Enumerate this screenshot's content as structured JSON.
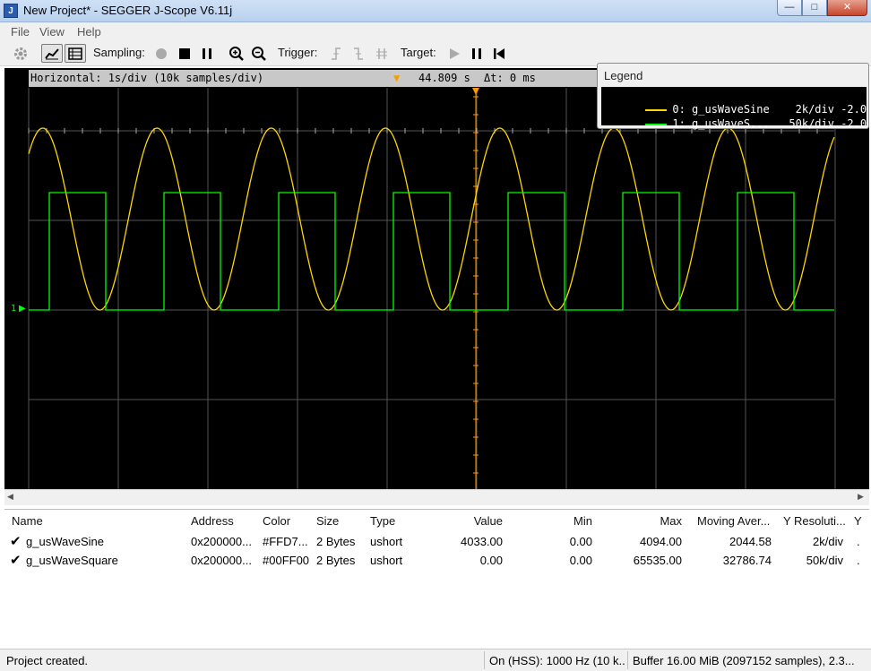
{
  "window": {
    "title": "New Project* - SEGGER J-Scope V6.11j",
    "app_icon": "J",
    "minimize": "—",
    "maximize": "□",
    "close": "✕"
  },
  "menu": [
    "File",
    "View",
    "Help"
  ],
  "toolbar": {
    "sampling_label": "Sampling:",
    "trigger_label": "Trigger:",
    "target_label": "Target:",
    "icons": [
      "gear-icon",
      "graph-view-icon",
      "table-view-icon",
      "record-icon",
      "stop-icon",
      "pause-icon",
      "zoom-in-icon",
      "zoom-out-icon",
      "trigger-rising-icon",
      "trigger-falling-icon",
      "trigger-both-icon",
      "play-icon",
      "pause-icon",
      "restart-icon"
    ]
  },
  "scope": {
    "horizontal": "Horizontal: 1s/div (10k samples/div)",
    "position": "44.809 s",
    "delta_t": "Δt: 0 ms",
    "channel_marker": "1",
    "background": "#000000",
    "grid_color": "#555555",
    "trigger_color": "#FF9900"
  },
  "legend": {
    "title": "Legend",
    "entries": [
      {
        "text": "0: g_usWaveSine    2k/div -2.0",
        "color": "#FFD700"
      },
      {
        "text": "1: g_usWaveS...   50k/div -2.0",
        "color": "#00FF00"
      }
    ]
  },
  "table": {
    "headers": [
      "Name",
      "Address",
      "Color",
      "Size",
      "Type",
      "Value",
      "Min",
      "Max",
      "Moving Aver...",
      "Y Resoluti...",
      "Y"
    ],
    "rows": [
      {
        "checked": "✔",
        "name": "g_usWaveSine",
        "address": "0x200000...",
        "color": "#FFD7...",
        "size": "2 Bytes",
        "type": "ushort",
        "value": "4033.00",
        "min": "0.00",
        "max": "4094.00",
        "avg": "2044.58",
        "yres": "2k/div",
        "y": "."
      },
      {
        "checked": "✔",
        "name": "g_usWaveSquare",
        "address": "0x200000...",
        "color": "#00FF00",
        "size": "2 Bytes",
        "type": "ushort",
        "value": "0.00",
        "min": "0.00",
        "max": "65535.00",
        "avg": "32786.74",
        "yres": "50k/div",
        "y": "."
      }
    ]
  },
  "status": {
    "message": "Project created.",
    "connection": "On (HSS): 1000 Hz (10 k...",
    "buffer": "Buffer 16.00 MiB (2097152 samples), 2.3..."
  }
}
